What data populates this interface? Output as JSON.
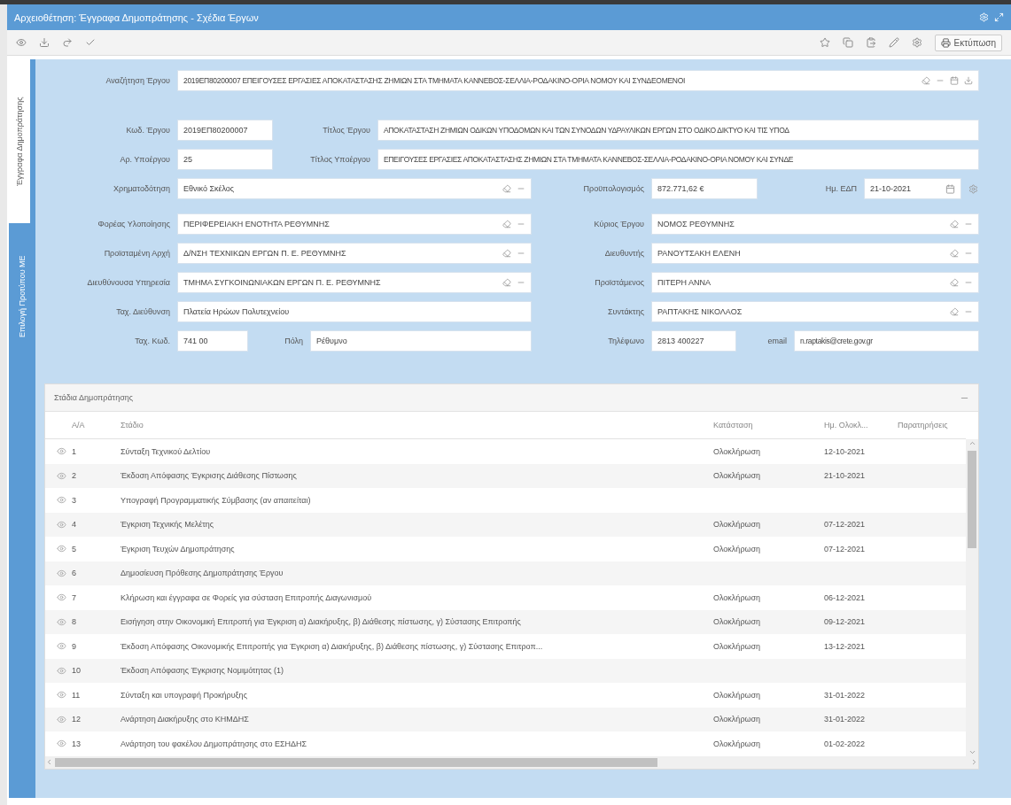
{
  "window": {
    "title": "Αρχειοθέτηση: Έγγραφα Δημοπράτησης - Σχέδια Έργων"
  },
  "toolbar": {
    "print_label": "Εκτύπωση"
  },
  "side_tabs": [
    {
      "label": "Έγγραφα Δημοπράτησης",
      "selected": true
    },
    {
      "label": "Επιλογή Προτύπου ΜΕ",
      "selected": false
    }
  ],
  "search": {
    "label": "Αναζήτηση Έργου",
    "value": "2019ΕΠ80200007 ΕΠΕΙΓΟΥΣΕΣ ΕΡΓΑΣΙΕΣ ΑΠΟΚΑΤΑΣΤΑΣΗΣ ΖΗΜΙΩΝ ΣΤΑ ΤΜΗΜΑΤΑ ΚΑΝΝΕΒΟΣ-ΣΕΛΛΙΑ-ΡΟΔΑΚΙΝΟ-ΟΡΙΑ ΝΟΜΟΥ ΚΑΙ ΣΥΝΔΕΟΜΕΝΟΙ"
  },
  "form_rows": [
    [
      {
        "label": "Κωδ. Έργου",
        "value": "2019ΕΠ80200007",
        "kind": "text"
      },
      {
        "label": "Τίτλος Έργου",
        "value": "ΑΠΟΚΑΤΑΣΤΑΣΗ ΖΗΜΙΩΝ ΟΔΙΚΩΝ ΥΠΟΔΟΜΩΝ ΚΑΙ ΤΩΝ ΣΥΝΟΔΩΝ ΥΔΡΑΥΛΙΚΩΝ ΕΡΓΩΝ ΣΤΟ ΟΔΙΚΟ ΔΙΚΤΥΟ ΚΑΙ ΤΙΣ ΥΠΟΔ",
        "kind": "text"
      }
    ],
    [
      {
        "label": "Αρ. Υποέργου",
        "value": "25",
        "kind": "text"
      },
      {
        "label": "Τίτλος Υποέργου",
        "value": "ΕΠΕΙΓΟΥΣΕΣ ΕΡΓΑΣΙΕΣ ΑΠΟΚΑΤΑΣΤΑΣΗΣ ΖΗΜΙΩΝ ΣΤΑ ΤΜΗΜΑΤΑ ΚΑΝΝΕΒΟΣ-ΣΕΛΛΙΑ-ΡΟΔΑΚΙΝΟ-ΟΡΙΑ ΝΟΜΟΥ ΚΑΙ ΣΥΝΔΕ",
        "kind": "text"
      }
    ],
    [
      {
        "label": "Χρηματοδότηση",
        "value": "Εθνικό Σκέλος",
        "kind": "lookup"
      },
      {
        "label": "Προϋπολογισμός",
        "value": "872.771,62 €",
        "kind": "text"
      },
      {
        "label": "Ημ. ΕΔΠ",
        "value": "21-10-2021",
        "kind": "date"
      }
    ],
    [
      {
        "label": "Φορέας Υλοποίησης",
        "value": "ΠΕΡΙΦΕΡΕΙΑΚΗ ΕΝΟΤΗΤΑ ΡΕΘΥΜΝΗΣ",
        "kind": "lookup"
      },
      {
        "label": "Κύριος Έργου",
        "value": "ΝΟΜΟΣ ΡΕΘΥΜΝΗΣ",
        "kind": "lookup"
      }
    ],
    [
      {
        "label": "Προϊσταμένη Αρχή",
        "value": "Δ/ΝΣΗ ΤΕΧΝΙΚΩΝ ΕΡΓΩΝ Π. Ε. ΡΕΘΥΜΝΗΣ",
        "kind": "lookup"
      },
      {
        "label": "Διευθυντής",
        "value": "ΡΑΝΟΥΤΣΑΚΗ ΕΛΕΝΗ",
        "kind": "lookup"
      }
    ],
    [
      {
        "label": "Διευθύνουσα Υπηρεσία",
        "value": "ΤΜΗΜΑ ΣΥΓΚΟΙΝΩΝΙΑΚΩΝ ΕΡΓΩΝ Π. Ε. ΡΕΘΥΜΝΗΣ",
        "kind": "lookup"
      },
      {
        "label": "Προϊστάμενος",
        "value": "ΠΙΤΕΡΗ ΑΝΝΑ",
        "kind": "lookup"
      }
    ],
    [
      {
        "label": "Ταχ. Διεύθυνση",
        "value": "Πλατεία Ηρώων Πολυτεχνείου",
        "kind": "text"
      },
      {
        "label": "Συντάκτης",
        "value": "ΡΑΠΤΑΚΗΣ ΝΙΚΟΛΑΟΣ",
        "kind": "lookup"
      }
    ],
    [
      {
        "label": "Ταχ. Κωδ.",
        "value": "741 00",
        "kind": "text"
      },
      {
        "label": "Πόλη",
        "value": "Ρέθυμνο",
        "kind": "text"
      },
      {
        "label": "Τηλέφωνο",
        "value": "2813 400227",
        "kind": "text"
      },
      {
        "label": "email",
        "value": "n.raptakis@crete.gov.gr",
        "kind": "text"
      }
    ]
  ],
  "stages": {
    "title": "Στάδια Δημοπράτησης",
    "columns": [
      "Α/Α",
      "Στάδιο",
      "Κατάσταση",
      "Ημ. Ολοκλ...",
      "Παρατηρήσεις"
    ],
    "rows": [
      [
        "1",
        "Σύνταξη Τεχνικού Δελτίου",
        "Ολοκλήρωση",
        "12-10-2021"
      ],
      [
        "2",
        "Έκδοση Απόφασης Έγκρισης Διάθεσης Πίστωσης",
        "Ολοκλήρωση",
        "21-10-2021"
      ],
      [
        "3",
        "Υπογραφή Προγραμματικής Σύμβασης (αν απαιτείται)",
        "",
        ""
      ],
      [
        "4",
        "Έγκριση Τεχνικής Μελέτης",
        "Ολοκλήρωση",
        "07-12-2021"
      ],
      [
        "5",
        "Έγκριση Τευχών Δημοπράτησης",
        "Ολοκλήρωση",
        "07-12-2021"
      ],
      [
        "6",
        "Δημοσίευση Πρόθεσης Δημοπράτησης Έργου",
        "",
        ""
      ],
      [
        "7",
        "Κλήρωση και έγγραφα σε Φορείς για σύσταση Επιτροπής Διαγωνισμού",
        "Ολοκλήρωση",
        "06-12-2021"
      ],
      [
        "8",
        "Εισήγηση στην Οικονομική Επιτροπή για Έγκριση α) Διακήρυξης, β) Διάθεσης πίστωσης, γ) Σύστασης Επιτροπής",
        "Ολοκλήρωση",
        "09-12-2021"
      ],
      [
        "9",
        "Έκδοση Απόφασης Οικονομικής Επιτροπής για Έγκριση α) Διακήρυξης, β) Διάθεσης πίστωσης, γ) Σύστασης Επιτροπ...",
        "Ολοκλήρωση",
        "13-12-2021"
      ],
      [
        "10",
        "Έκδοση Απόφασης Έγκρισης Νομιμότητας (1)",
        "",
        ""
      ],
      [
        "11",
        "Σύνταξη και υπογραφή Προκήρυξης",
        "Ολοκλήρωση",
        "31-01-2022"
      ],
      [
        "12",
        "Ανάρτηση Διακήρυξης στο ΚΗΜΔΗΣ",
        "Ολοκλήρωση",
        "31-01-2022"
      ],
      [
        "13",
        "Ανάρτηση του φακέλου Δημοπράτησης στο ΕΣΗΔΗΣ",
        "Ολοκλήρωση",
        "01-02-2022"
      ]
    ]
  }
}
